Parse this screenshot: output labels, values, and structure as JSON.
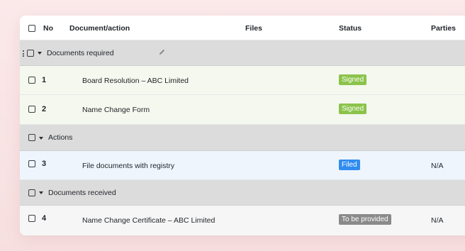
{
  "header": {
    "no": "No",
    "document": "Document/action",
    "files": "Files",
    "status": "Status",
    "parties": "Parties"
  },
  "groups": [
    {
      "label": "Documents required"
    },
    {
      "label": "Actions"
    },
    {
      "label": "Documents received"
    }
  ],
  "rows": [
    {
      "no": "1",
      "name": "Board Resolution – ABC Limited",
      "status": "Signed",
      "parties": ""
    },
    {
      "no": "2",
      "name": "Name Change Form",
      "status": "Signed",
      "parties": ""
    },
    {
      "no": "3",
      "name": "File documents with registry",
      "status": "Filed",
      "parties": "N/A"
    },
    {
      "no": "4",
      "name": "Name Change Certificate – ABC Limited",
      "status": "To be provided",
      "parties": "N/A"
    }
  ],
  "colors": {
    "signed": "#8bc34a",
    "filed": "#2f8cf0",
    "to_be_provided": "#8a8a8a",
    "row_green": "#f4f8ee",
    "row_blue": "#eef5fd",
    "row_grey": "#f6f6f6",
    "group_bg": "#dcdcdc"
  }
}
